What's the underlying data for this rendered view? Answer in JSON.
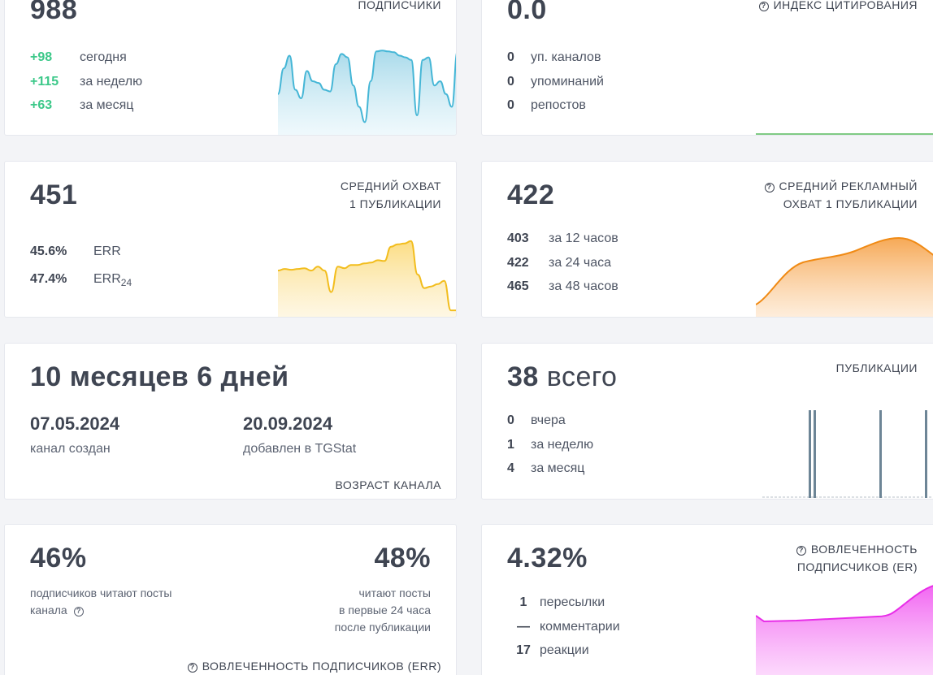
{
  "subscribers": {
    "value": "988",
    "caption": "ПОДПИСЧИКИ",
    "stats": [
      {
        "num": "+98",
        "label": "сегодня"
      },
      {
        "num": "+115",
        "label": "за неделю"
      },
      {
        "num": "+63",
        "label": "за месяц"
      }
    ],
    "spark_color": "#45b6d6",
    "spark_values": [
      0.45,
      0.75,
      0.9,
      0.5,
      0.4,
      0.72,
      0.6,
      0.58,
      0.5,
      0.48,
      0.8,
      0.92,
      0.88,
      0.55,
      0.3,
      0.12,
      0.6,
      0.95,
      0.96,
      0.95,
      0.94,
      0.9,
      0.88,
      0.85,
      0.2,
      0.85,
      0.88,
      0.55,
      0.6,
      0.45,
      0.3,
      0.95
    ]
  },
  "citation": {
    "value": "0.0",
    "caption": "ИНДЕКС ЦИТИРОВАНИЯ",
    "stats": [
      {
        "num": "0",
        "label": "уп. каналов"
      },
      {
        "num": "0",
        "label": "упоминаний"
      },
      {
        "num": "0",
        "label": "репостов"
      }
    ],
    "spark_color": "#55b85c"
  },
  "reach": {
    "value": "451",
    "caption_line1": "СРЕДНИЙ ОХВАТ",
    "caption_line2": "1 ПУБЛИКАЦИИ",
    "err_value": "45.6%",
    "err_label": "ERR",
    "err24_value": "47.4%",
    "err24_label": "ERR",
    "err24_sub": "24",
    "spark_color": "#f2bd1d",
    "spark_values": [
      0.55,
      0.57,
      0.56,
      0.57,
      0.58,
      0.55,
      0.6,
      0.55,
      0.28,
      0.6,
      0.58,
      0.62,
      0.62,
      0.64,
      0.65,
      0.68,
      0.67,
      0.85,
      0.88,
      0.89,
      0.92,
      0.5,
      0.33,
      0.35,
      0.38,
      0.42,
      0.05,
      0.05
    ]
  },
  "ad_reach": {
    "value": "422",
    "caption_line1": "СРЕДНИЙ РЕКЛАМНЫЙ",
    "caption_line2": "ОХВАТ 1 ПУБЛИКАЦИИ",
    "stats": [
      {
        "num": "403",
        "label": "за 12 часов"
      },
      {
        "num": "422",
        "label": "за 24 часа"
      },
      {
        "num": "465",
        "label": "за 48 часов"
      }
    ],
    "spark_color": "#f08a14"
  },
  "age": {
    "value": "10 месяцев 6 дней",
    "created_date": "07.05.2024",
    "created_label": "канал создан",
    "added_date": "20.09.2024",
    "added_label": "добавлен в TGStat",
    "caption": "ВОЗРАСТ КАНАЛА"
  },
  "posts": {
    "value_num": "38",
    "value_word": "всего",
    "caption": "ПУБЛИКАЦИИ",
    "stats": [
      {
        "num": "0",
        "label": "вчера"
      },
      {
        "num": "1",
        "label": "за неделю"
      },
      {
        "num": "4",
        "label": "за месяц"
      }
    ],
    "bar_color": "#6d8596"
  },
  "read": {
    "left_value": "46%",
    "left_label_1": "подписчиков читают посты",
    "left_label_2": "канала",
    "right_value": "48%",
    "right_label_1": "читают посты",
    "right_label_2": "в первые 24 часа",
    "right_label_3": "после публикации",
    "caption": "ВОВЛЕЧЕННОСТЬ ПОДПИСЧИКОВ (ERR)"
  },
  "er": {
    "value": "4.32%",
    "caption_line1": "ВОВЛЕЧЕННОСТЬ",
    "caption_line2": "ПОДПИСЧИКОВ (ER)",
    "stats": [
      {
        "num": "1",
        "label": "пересылки"
      },
      {
        "num": "—",
        "label": "комментарии"
      },
      {
        "num": "17",
        "label": "реакции"
      }
    ],
    "spark_color": "#e82ee8"
  }
}
